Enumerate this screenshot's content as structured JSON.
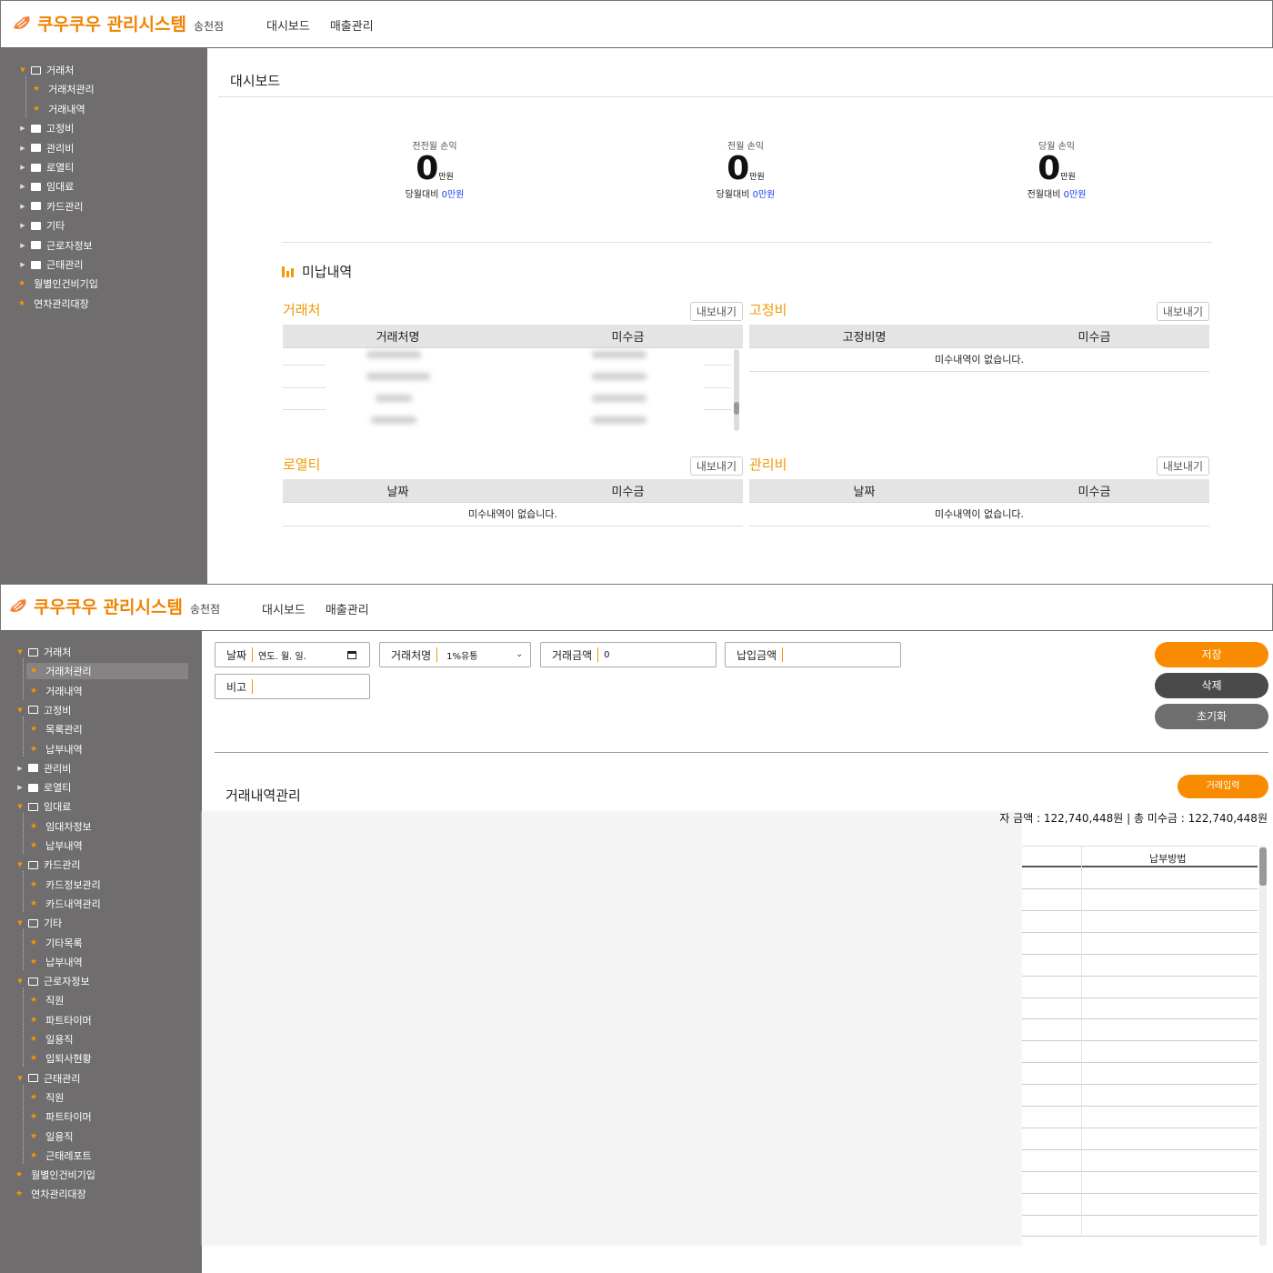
{
  "app": {
    "title": "쿠우쿠우 관리시스템",
    "branch": "송천점",
    "nav": [
      "대시보드",
      "매출관리"
    ]
  },
  "sidebar_top": [
    {
      "label": "거래처",
      "type": "folder-open"
    },
    {
      "label": "거래처관리",
      "type": "leaf"
    },
    {
      "label": "거래내역",
      "type": "leaf"
    },
    {
      "label": "고정비",
      "type": "folder"
    },
    {
      "label": "관리비",
      "type": "folder"
    },
    {
      "label": "로열티",
      "type": "folder"
    },
    {
      "label": "임대료",
      "type": "folder"
    },
    {
      "label": "카드관리",
      "type": "folder"
    },
    {
      "label": "기타",
      "type": "folder"
    },
    {
      "label": "근로자정보",
      "type": "folder"
    },
    {
      "label": "근태관리",
      "type": "folder"
    },
    {
      "label": "월별인건비기입",
      "type": "root-leaf"
    },
    {
      "label": "연차관리대장",
      "type": "root-leaf"
    }
  ],
  "dashboard": {
    "title": "대시보드",
    "stats": [
      {
        "label": "전전월 손익",
        "value": "0",
        "unit": "만원",
        "compare_label": "당월대비",
        "compare_value": "0만원"
      },
      {
        "label": "전월 손익",
        "value": "0",
        "unit": "만원",
        "compare_label": "당월대비",
        "compare_value": "0만원"
      },
      {
        "label": "당월 손익",
        "value": "0",
        "unit": "만원",
        "compare_label": "전월대비",
        "compare_value": "0만원"
      }
    ],
    "unpaid_title": "미납내역",
    "export_label": "내보내기",
    "empty_text": "미수내역이 없습니다.",
    "panels": [
      {
        "title": "거래처",
        "columns": [
          "거래처명",
          "미수금"
        ]
      },
      {
        "title": "고정비",
        "columns": [
          "고정비명",
          "미수금"
        ]
      },
      {
        "title": "로열티",
        "columns": [
          "날짜",
          "미수금"
        ]
      },
      {
        "title": "관리비",
        "columns": [
          "날짜",
          "미수금"
        ]
      }
    ]
  },
  "sidebar_bottom": [
    {
      "label": "거래처",
      "type": "folder-open"
    },
    {
      "label": "거래처관리",
      "type": "leaf",
      "selected": true
    },
    {
      "label": "거래내역",
      "type": "leaf"
    },
    {
      "label": "고정비",
      "type": "folder-open"
    },
    {
      "label": "목록관리",
      "type": "leaf"
    },
    {
      "label": "납부내역",
      "type": "leaf"
    },
    {
      "label": "관리비",
      "type": "folder"
    },
    {
      "label": "로열티",
      "type": "folder"
    },
    {
      "label": "임대료",
      "type": "folder-open"
    },
    {
      "label": "임대차정보",
      "type": "leaf"
    },
    {
      "label": "납부내역",
      "type": "leaf"
    },
    {
      "label": "카드관리",
      "type": "folder-open"
    },
    {
      "label": "카드정보관리",
      "type": "leaf"
    },
    {
      "label": "카드내역관리",
      "type": "leaf"
    },
    {
      "label": "기타",
      "type": "folder-open"
    },
    {
      "label": "기타목록",
      "type": "leaf"
    },
    {
      "label": "납부내역",
      "type": "leaf"
    },
    {
      "label": "근로자정보",
      "type": "folder-open"
    },
    {
      "label": "직원",
      "type": "leaf"
    },
    {
      "label": "파트타이머",
      "type": "leaf"
    },
    {
      "label": "일용직",
      "type": "leaf"
    },
    {
      "label": "입퇴사현황",
      "type": "leaf"
    },
    {
      "label": "근태관리",
      "type": "folder-open"
    },
    {
      "label": "직원",
      "type": "leaf"
    },
    {
      "label": "파트타이머",
      "type": "leaf"
    },
    {
      "label": "일용직",
      "type": "leaf"
    },
    {
      "label": "근태레포트",
      "type": "leaf"
    },
    {
      "label": "월별인건비기입",
      "type": "root-leaf"
    },
    {
      "label": "연차관리대장",
      "type": "root-leaf"
    }
  ],
  "form": {
    "date_label": "날짜",
    "date_placeholder": "연도. 월. 일.",
    "vendor_label": "거래처명",
    "vendor_value": "1%유통",
    "amount_label": "거래금액",
    "amount_value": "0",
    "paid_label": "납입금액",
    "note_label": "비고",
    "save": "저장",
    "delete": "삭제",
    "reset": "초기화"
  },
  "history": {
    "title": "거래내역관리",
    "add_button": "거래입력",
    "totals_text": "자 금액 : 122,740,448원 | 총 미수금 : 122,740,448원",
    "visible_column": "납부방법"
  },
  "colors": {
    "accent": "#f39800",
    "sidebar": "#6f6d6d",
    "delete_btn": "#4a4a4a",
    "reset_btn": "#6e6e6e"
  }
}
